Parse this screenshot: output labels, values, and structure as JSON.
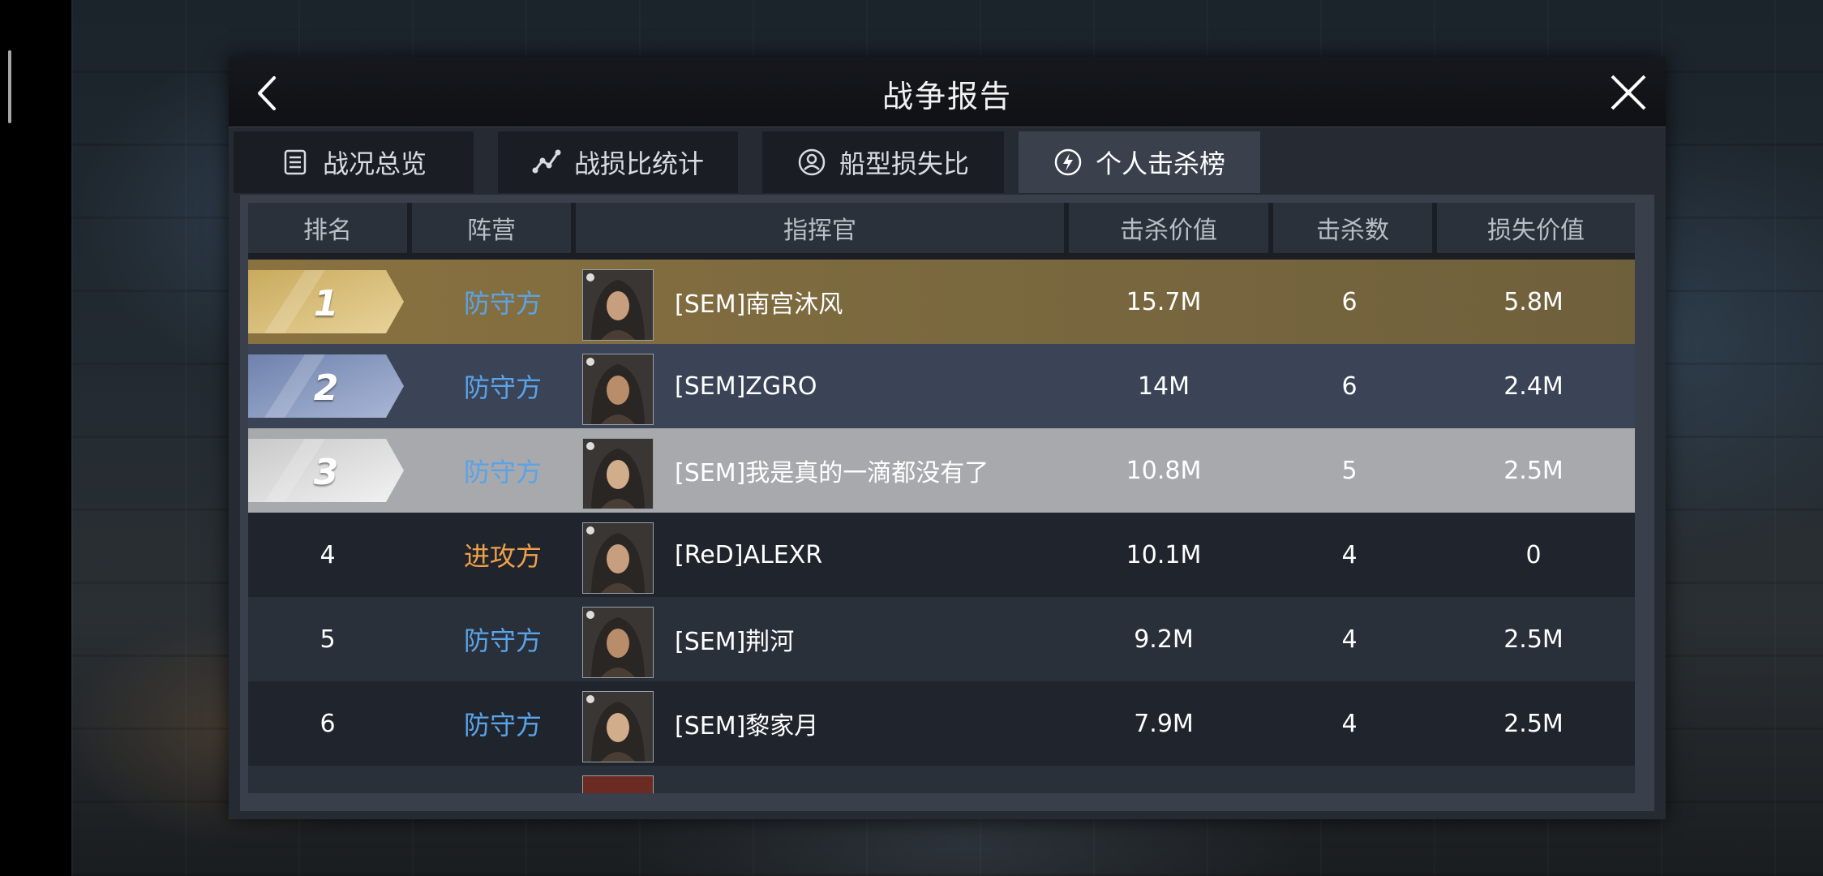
{
  "header": {
    "title": "战争报告"
  },
  "tabs": [
    {
      "label": "战况总览",
      "icon": "document-list-icon",
      "active": false
    },
    {
      "label": "战损比统计",
      "icon": "line-chart-icon",
      "active": false
    },
    {
      "label": "船型损失比",
      "icon": "ship-type-icon",
      "active": false
    },
    {
      "label": "个人击杀榜",
      "icon": "lightning-circle-icon",
      "active": true
    }
  ],
  "table": {
    "headers": [
      "排名",
      "阵营",
      "指挥官",
      "击杀价值",
      "击杀数",
      "损失价值"
    ],
    "rows": [
      {
        "rank": "1",
        "camp": "防守方",
        "camp_type": "defense",
        "commander": "[SEM]南宫沐风",
        "kill_value": "15.7M",
        "kills": "6",
        "loss_value": "5.8M",
        "style": "gold"
      },
      {
        "rank": "2",
        "camp": "防守方",
        "camp_type": "defense",
        "commander": "[SEM]ZGRO",
        "kill_value": "14M",
        "kills": "6",
        "loss_value": "2.4M",
        "style": "blue"
      },
      {
        "rank": "3",
        "camp": "防守方",
        "camp_type": "defense",
        "commander": "[SEM]我是真的一滴都没有了",
        "kill_value": "10.8M",
        "kills": "5",
        "loss_value": "2.5M",
        "style": "silver"
      },
      {
        "rank": "4",
        "camp": "进攻方",
        "camp_type": "attack",
        "commander": "[ReD]ALEXR",
        "kill_value": "10.1M",
        "kills": "4",
        "loss_value": "0",
        "style": "dark1"
      },
      {
        "rank": "5",
        "camp": "防守方",
        "camp_type": "defense",
        "commander": "[SEM]荆河",
        "kill_value": "9.2M",
        "kills": "4",
        "loss_value": "2.5M",
        "style": "dark2"
      },
      {
        "rank": "6",
        "camp": "防守方",
        "camp_type": "defense",
        "commander": "[SEM]黎家月",
        "kill_value": "7.9M",
        "kills": "4",
        "loss_value": "2.5M",
        "style": "dark1"
      }
    ]
  },
  "colors": {
    "defense": "#5aa3e8",
    "attack": "#f0a04a",
    "gold_row": "#7d6a3f",
    "blue_row": "#3b4457",
    "silver_row": "#a7a9ac"
  }
}
